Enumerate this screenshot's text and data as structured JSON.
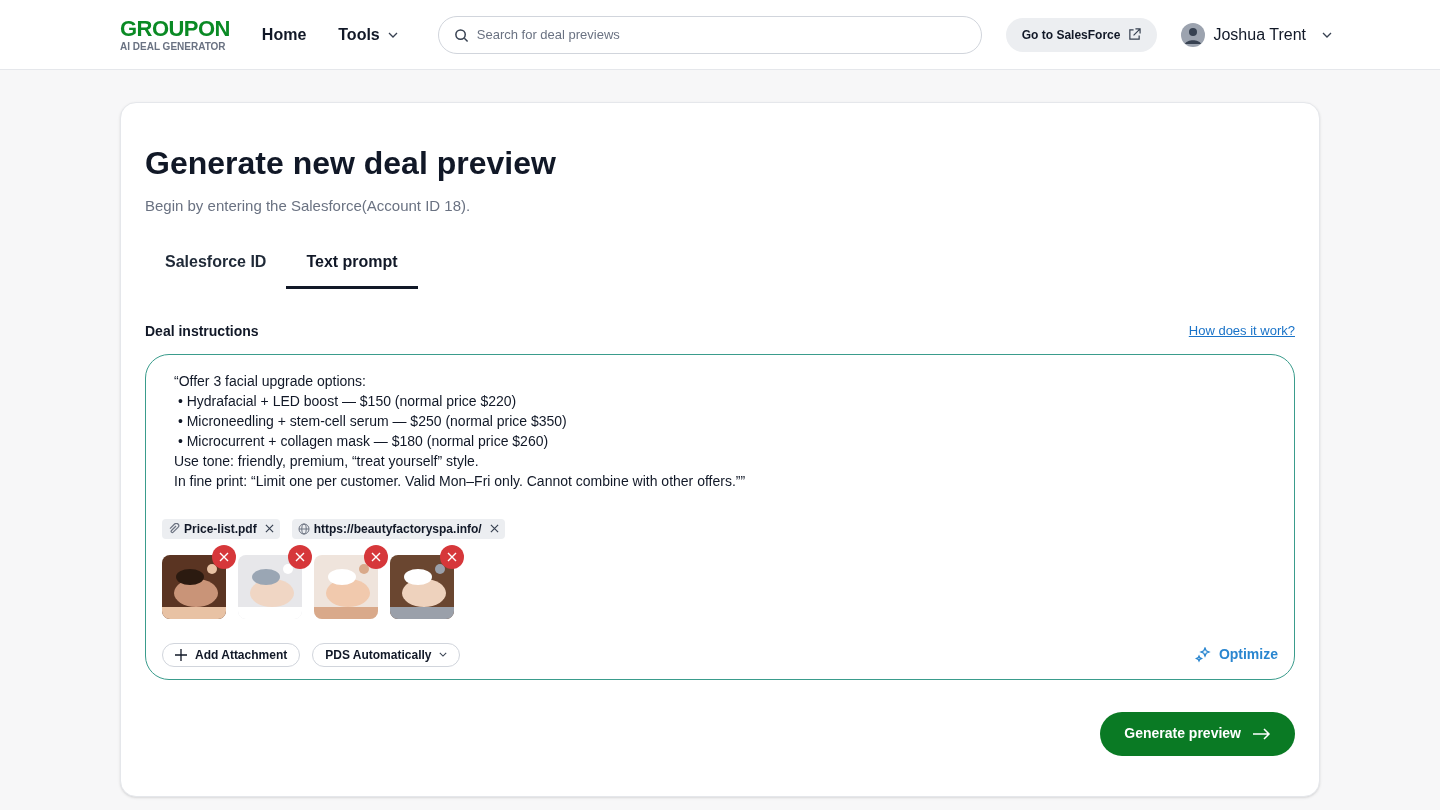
{
  "header": {
    "logo": "GROUPON",
    "logo_subtitle": "AI DEAL GENERATOR",
    "nav": [
      {
        "label": "Home",
        "kind": "link"
      },
      {
        "label": "Tools",
        "kind": "dropdown"
      }
    ],
    "search": {
      "placeholder": "Search for deal previews"
    },
    "salesforce_button": "Go to SalesForce",
    "user": {
      "name": "Joshua Trent"
    }
  },
  "card": {
    "title": "Generate new deal preview",
    "subtitle": "Begin by entering the Salesforce(Account ID 18).",
    "tabs": [
      {
        "label": "Salesforce ID",
        "selected": false
      },
      {
        "label": "Text prompt",
        "selected": true
      }
    ],
    "field_label": "Deal instructions",
    "help_link": "How does it work?",
    "prompt_lines": [
      "“Offer 3 facial upgrade options:",
      " • Hydrafacial + LED boost — $150 (normal price $220)",
      " • Microneedling + stem-cell serum — $250 (normal price $350)",
      " • Microcurrent + collagen mask — $180 (normal price $260)",
      "Use tone: friendly, premium, “treat yourself” style.",
      "In fine print: “Limit one per customer. Valid Mon–Fri only. Cannot combine with other offers.””"
    ],
    "attachments": [
      {
        "kind": "file",
        "label": "Price-list.pdf"
      },
      {
        "kind": "link",
        "label": "https://beautyfactoryspa.info/"
      }
    ],
    "add_attachment": "Add Attachment",
    "pds_dropdown": "PDS Automatically",
    "optimize": "Optimize",
    "generate_button": "Generate preview"
  }
}
